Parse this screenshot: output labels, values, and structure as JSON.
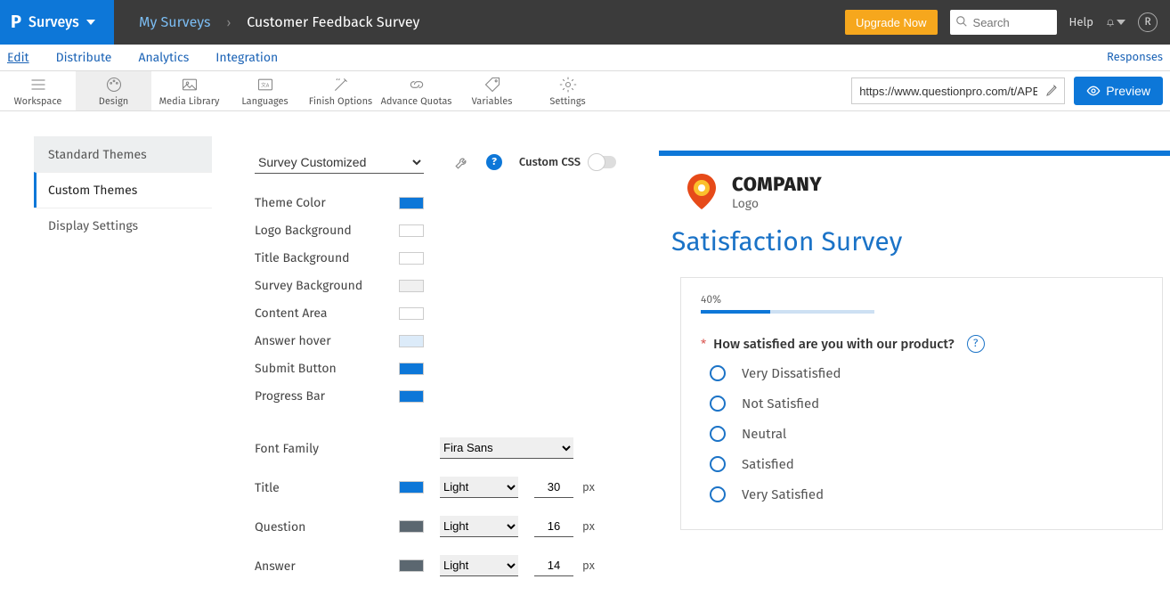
{
  "topbar": {
    "brand_initial": "P",
    "surveys_label": "Surveys",
    "breadcrumb_root": "My Surveys",
    "breadcrumb_title": "Customer Feedback Survey",
    "upgrade_label": "Upgrade Now",
    "search_placeholder": "Search",
    "help_label": "Help",
    "avatar_initial": "R"
  },
  "subnav": {
    "edit": "Edit",
    "distribute": "Distribute",
    "analytics": "Analytics",
    "integration": "Integration",
    "responses": "Responses"
  },
  "toolbar": {
    "workspace": "Workspace",
    "design": "Design",
    "media": "Media Library",
    "languages": "Languages",
    "finish": "Finish Options",
    "quotas": "Advance Quotas",
    "variables": "Variables",
    "settings": "Settings",
    "url": "https://www.questionpro.com/t/APEvHZeq",
    "preview": "Preview"
  },
  "side_tabs": {
    "standard": "Standard Themes",
    "custom": "Custom Themes",
    "display": "Display Settings"
  },
  "settings": {
    "theme_selected": "Survey Customized",
    "custom_css_label": "Custom CSS",
    "colors": {
      "theme_color": {
        "label": "Theme Color",
        "hex": "#0d77d8"
      },
      "logo_bg": {
        "label": "Logo Background",
        "hex": "#ffffff"
      },
      "title_bg": {
        "label": "Title Background",
        "hex": "#ffffff"
      },
      "survey_bg": {
        "label": "Survey Background",
        "hex": "#f0f0f0"
      },
      "content_area": {
        "label": "Content Area",
        "hex": "#ffffff"
      },
      "answer_hover": {
        "label": "Answer hover",
        "hex": "#dcebf9"
      },
      "submit_button": {
        "label": "Submit Button",
        "hex": "#0d77d8"
      },
      "progress_bar": {
        "label": "Progress Bar",
        "hex": "#0d77d8"
      }
    },
    "font_family_label": "Font Family",
    "font_family_value": "Fira Sans",
    "typography": {
      "title": {
        "label": "Title",
        "color": "#0d77d8",
        "weight": "Light",
        "size": "30",
        "unit": "px"
      },
      "question": {
        "label": "Question",
        "color": "#5b6770",
        "weight": "Light",
        "size": "16",
        "unit": "px"
      },
      "answer": {
        "label": "Answer",
        "color": "#5b6770",
        "weight": "Light",
        "size": "14",
        "unit": "px"
      }
    }
  },
  "preview": {
    "company": "COMPANY",
    "logo_sub": "Logo",
    "survey_title": "Satisfaction Survey",
    "progress_pct": "40%",
    "question_star": "*",
    "question_text": "How satisfied are you with our product?",
    "answers": [
      "Very Dissatisfied",
      "Not Satisfied",
      "Neutral",
      "Satisfied",
      "Very Satisfied"
    ]
  }
}
